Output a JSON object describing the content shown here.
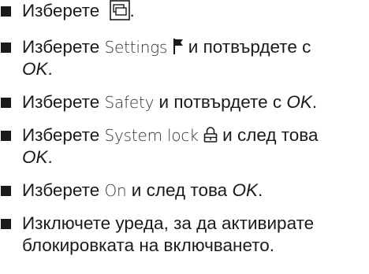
{
  "steps": [
    {
      "pre": "Изберете",
      "icon": "window-copy-icon",
      "post": "."
    },
    {
      "pre": "Изберете",
      "ui": "Settings",
      "icon": "flag-icon",
      "mid": "и потвърдете с",
      "ok": "OK",
      "post": "."
    },
    {
      "pre": "Изберете",
      "ui": "Safety",
      "mid": "и потвърдете с",
      "ok": "OK",
      "post": "."
    },
    {
      "pre": "Изберете",
      "ui": "System lock",
      "icon": "padlock-icon",
      "mid": "и след това",
      "ok": "OK",
      "post": "."
    },
    {
      "pre": "Изберете",
      "ui": "On",
      "mid": "и след това",
      "ok": "OK",
      "post": "."
    },
    {
      "text": "Изключете уреда, за да активирате блокировката на включването."
    }
  ]
}
